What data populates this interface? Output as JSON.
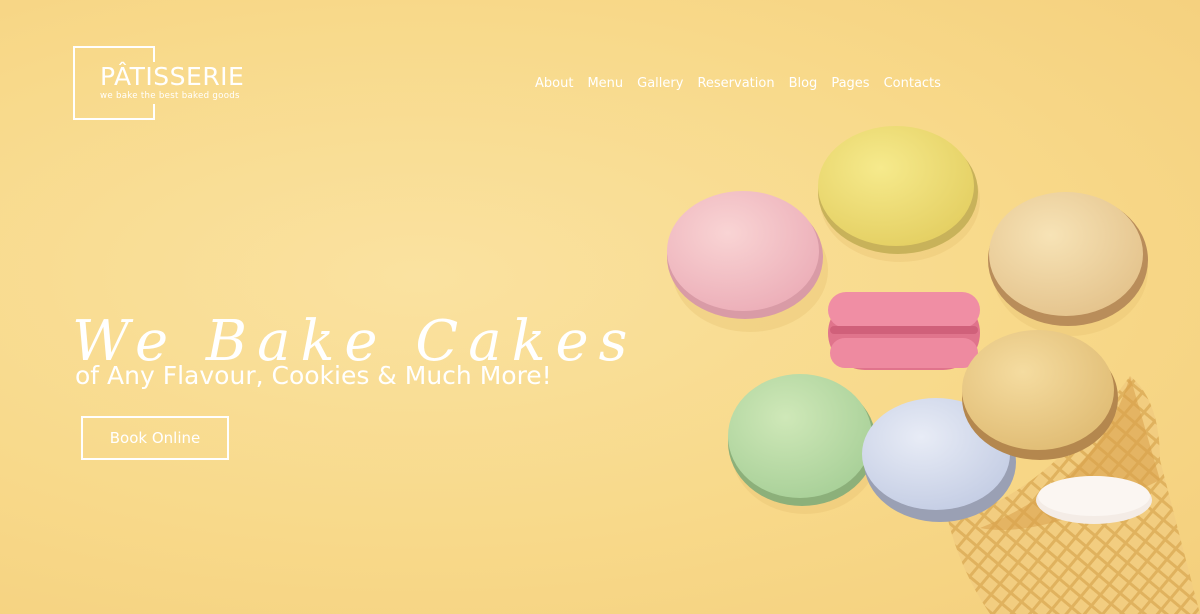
{
  "logo": {
    "title": "PÂTISSERIE",
    "tagline": "we bake the best  baked goods"
  },
  "nav": {
    "items": [
      "About",
      "Menu",
      "Gallery",
      "Reservation",
      "Blog",
      "Pages",
      "Contacts"
    ]
  },
  "hero": {
    "script_title": "We Bake Cakes",
    "subtitle": "of Any Flavour, Cookies & Much More!",
    "cta_label": "Book Online"
  },
  "colors": {
    "background": "#f8d98a",
    "text": "#ffffff",
    "macaron_pink": "#f2b8c0",
    "macaron_yellow": "#eedd72",
    "macaron_beige": "#f0d6a4",
    "macaron_hotpink": "#ee7e98",
    "macaron_green": "#b9dca6",
    "macaron_blue": "#d6dcec",
    "macaron_tan": "#eccf8e",
    "waffle_cone": "#f0c878"
  },
  "icons": {
    "hero_image": "macarons-and-waffle-cone-image"
  }
}
